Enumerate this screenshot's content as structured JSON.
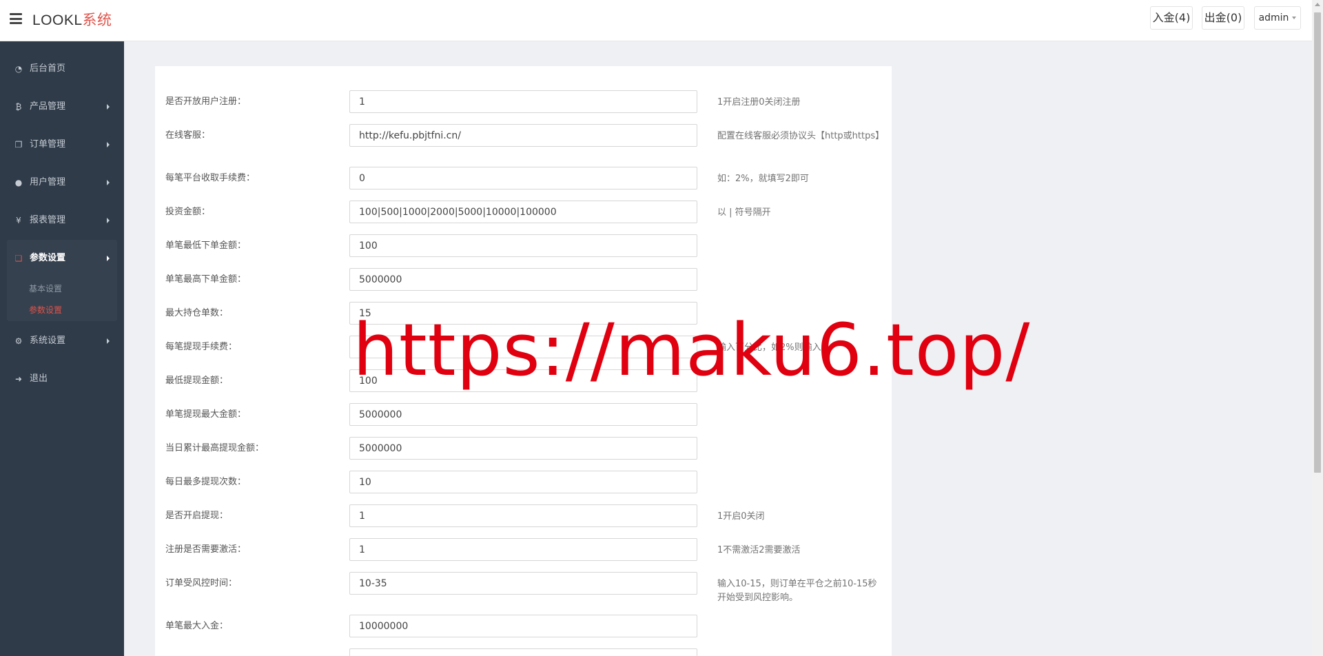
{
  "header": {
    "logo_text": "LOOKL",
    "logo_accent": "系统",
    "deposit_label": "入金(4)",
    "withdraw_label": "出金(0)",
    "user_label": "admin"
  },
  "sidebar": {
    "items": [
      {
        "label": "后台首页",
        "icon": "dashboard-icon"
      },
      {
        "label": "产品管理",
        "icon": "bitcoin-icon"
      },
      {
        "label": "订单管理",
        "icon": "copy-icon"
      },
      {
        "label": "用户管理",
        "icon": "user-icon"
      },
      {
        "label": "报表管理",
        "icon": "yen-icon"
      },
      {
        "label": "参数设置",
        "icon": "files-icon"
      },
      {
        "label": "系统设置",
        "icon": "cogs-icon"
      },
      {
        "label": "退出",
        "icon": "sign-out-icon"
      }
    ],
    "submenu": [
      {
        "label": "基本设置"
      },
      {
        "label": "参数设置"
      }
    ]
  },
  "form": {
    "rows": [
      {
        "label": "是否开放用户注册：",
        "value": "1",
        "hint": "1开启注册0关闭注册"
      },
      {
        "label": "在线客服：",
        "value": "http://kefu.pbjtfni.cn/",
        "hint": "配置在线客服必须协议头【http或https】"
      },
      {
        "label": "每笔平台收取手续费：",
        "value": "0",
        "hint": "如：2%，就填写2即可"
      },
      {
        "label": "投资金额：",
        "value": "100|500|1000|2000|5000|10000|100000",
        "hint": "以 | 符号隔开"
      },
      {
        "label": "单笔最低下单金额：",
        "value": "100",
        "hint": ""
      },
      {
        "label": "单笔最高下单金额：",
        "value": "5000000",
        "hint": ""
      },
      {
        "label": "最大持仓单数：",
        "value": "15",
        "hint": ""
      },
      {
        "label": "每笔提现手续费：",
        "value": "",
        "hint": "输入百分比，如2%则输入2"
      },
      {
        "label": "最低提现金额：",
        "value": "100",
        "hint": ""
      },
      {
        "label": "单笔提现最大金额：",
        "value": "5000000",
        "hint": ""
      },
      {
        "label": "当日累计最高提现金额：",
        "value": "5000000",
        "hint": ""
      },
      {
        "label": "每日最多提现次数：",
        "value": "10",
        "hint": ""
      },
      {
        "label": "是否开启提现：",
        "value": "1",
        "hint": "1开启0关闭"
      },
      {
        "label": "注册是否需要激活：",
        "value": "1",
        "hint": "1不需激活2需要激活"
      },
      {
        "label": "订单受风控时间：",
        "value": "10-35",
        "hint": "输入10-15，则订单在平仓之前10-15秒开始受到风控影响。"
      },
      {
        "label": "单笔最大入金：",
        "value": "10000000",
        "hint": ""
      },
      {
        "label": "",
        "value": "",
        "hint": ""
      }
    ]
  },
  "watermark": "https://maku6.top/"
}
